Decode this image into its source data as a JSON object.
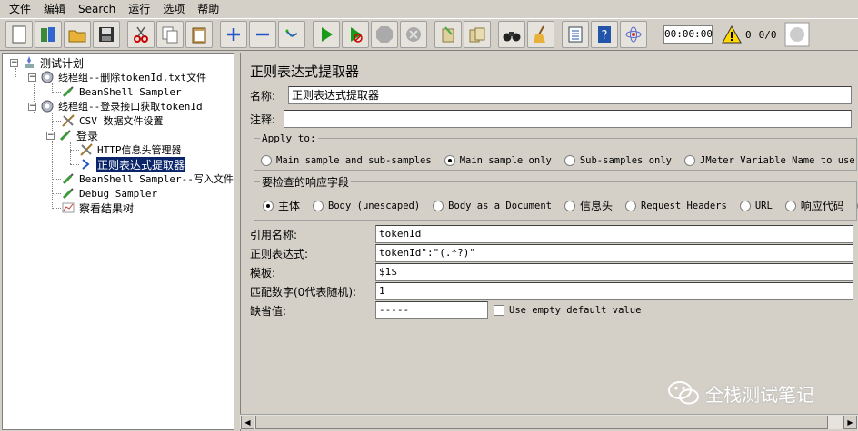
{
  "menu": [
    "文件",
    "编辑",
    "Search",
    "运行",
    "选项",
    "帮助"
  ],
  "toolbar": {
    "timer": "00:00:00",
    "errors": "0",
    "threads": "0/0"
  },
  "tree": {
    "items": [
      {
        "label": "测试计划"
      },
      {
        "label": "线程组--删除tokenId.txt文件"
      },
      {
        "label": "BeanShell Sampler"
      },
      {
        "label": "线程组--登录接口获取tokenId"
      },
      {
        "label": "CSV 数据文件设置"
      },
      {
        "label": "登录"
      },
      {
        "label": "HTTP信息头管理器"
      },
      {
        "label": "正则表达式提取器"
      },
      {
        "label": "BeanShell Sampler--写入文件"
      },
      {
        "label": "Debug Sampler"
      },
      {
        "label": "察看结果树"
      }
    ]
  },
  "editor": {
    "title": "正则表达式提取器",
    "name_label": "名称:",
    "name_value": "正则表达式提取器",
    "comment_label": "注释:",
    "comment_value": "",
    "apply_to": {
      "legend": "Apply to:",
      "options": [
        "Main sample and sub-samples",
        "Main sample only",
        "Sub-samples only",
        "JMeter Variable Name to use"
      ],
      "selected": 1
    },
    "response_field": {
      "legend": "要检查的响应字段",
      "options": [
        "主体",
        "Body (unescaped)",
        "Body as a Document",
        "信息头",
        "Request Headers",
        "URL",
        "响应代码",
        "响"
      ],
      "selected": 0
    },
    "ref_name_label": "引用名称:",
    "ref_name_value": "tokenId",
    "regex_label": "正则表达式:",
    "regex_value": "tokenId\":\"(.*?)\"",
    "template_label": "模板:",
    "template_value": "$1$",
    "match_no_label": "匹配数字(0代表随机):",
    "match_no_value": "1",
    "default_label": "缺省值:",
    "default_value": "-----",
    "use_empty_label": "Use empty default value"
  },
  "watermark": "全栈测试笔记"
}
